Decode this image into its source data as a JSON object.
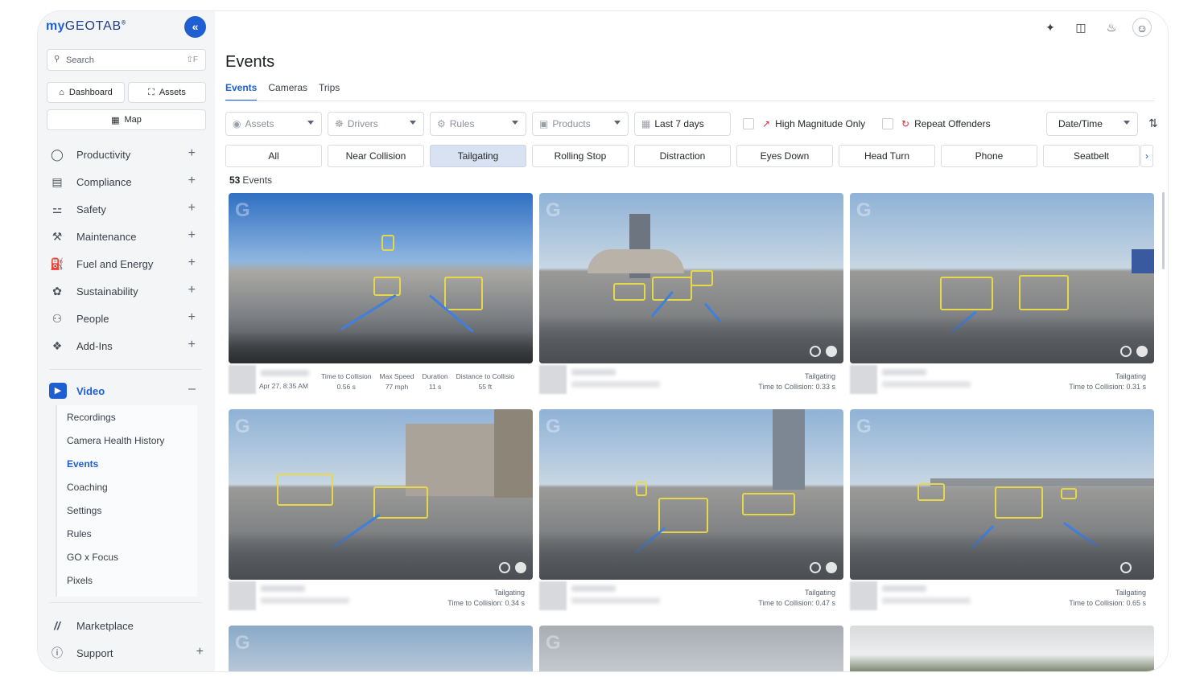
{
  "app": {
    "logo_my": "my",
    "logo_geotab": "GEOTAB",
    "logo_mark": "®"
  },
  "sidebar": {
    "search_label": "Search",
    "search_shortcut": "⇧F",
    "quick": {
      "dashboard": "Dashboard",
      "assets": "Assets",
      "map": "Map"
    },
    "items": [
      {
        "label": "Productivity",
        "icon": "globe-icon"
      },
      {
        "label": "Compliance",
        "icon": "clipboard-icon"
      },
      {
        "label": "Safety",
        "icon": "safety-icon"
      },
      {
        "label": "Maintenance",
        "icon": "wrench-icon"
      },
      {
        "label": "Fuel and Energy",
        "icon": "fuel-icon"
      },
      {
        "label": "Sustainability",
        "icon": "leaf-icon"
      },
      {
        "label": "People",
        "icon": "people-icon"
      },
      {
        "label": "Add-Ins",
        "icon": "puzzle-icon"
      }
    ],
    "video": {
      "label": "Video",
      "sub": [
        "Recordings",
        "Camera Health History",
        "Events",
        "Coaching",
        "Settings",
        "Rules",
        "GO x Focus",
        "Pixels"
      ],
      "active": "Events"
    },
    "marketplace": "Marketplace",
    "support": "Support"
  },
  "header": {
    "title": "Events",
    "tabs": [
      "Events",
      "Cameras",
      "Trips"
    ],
    "active_tab": "Events"
  },
  "filters": {
    "assets": "Assets",
    "drivers": "Drivers",
    "rules": "Rules",
    "products": "Products",
    "date_range": "Last 7 days",
    "high_magnitude": "High Magnitude Only",
    "repeat_offenders": "Repeat Offenders",
    "sort": "Date/Time"
  },
  "chips": [
    "All",
    "Near Collision",
    "Tailgating",
    "Rolling Stop",
    "Distraction",
    "Eyes Down",
    "Head Turn",
    "Phone",
    "Seatbelt"
  ],
  "active_chip": "Tailgating",
  "events_count": "53",
  "events_label": "Events",
  "cards": [
    {
      "type": "detail",
      "stats": [
        {
          "label": "Time to Collision",
          "value": "0.56 s"
        },
        {
          "label": "Max Speed",
          "value": "77 mph"
        },
        {
          "label": "Duration",
          "value": "11 s"
        },
        {
          "label": "Distance to Collisio",
          "value": "55 ft"
        }
      ],
      "date": "Apr 27, 8:35 AM"
    },
    {
      "type": "simple",
      "event": "Tailgating",
      "detail": "Time to Collision: 0.33 s"
    },
    {
      "type": "simple",
      "event": "Tailgating",
      "detail": "Time to Collision: 0.31 s"
    },
    {
      "type": "simple",
      "event": "Tailgating",
      "detail": "Time to Collision: 0.34 s"
    },
    {
      "type": "simple",
      "event": "Tailgating",
      "detail": "Time to Collision: 0.47 s"
    },
    {
      "type": "simple",
      "event": "Tailgating",
      "detail": "Time to Collision: 0.65 s"
    }
  ],
  "colors": {
    "accent": "#1f5fd1",
    "chip_active": "#d8e2f0",
    "alert": "#d22d3a"
  }
}
